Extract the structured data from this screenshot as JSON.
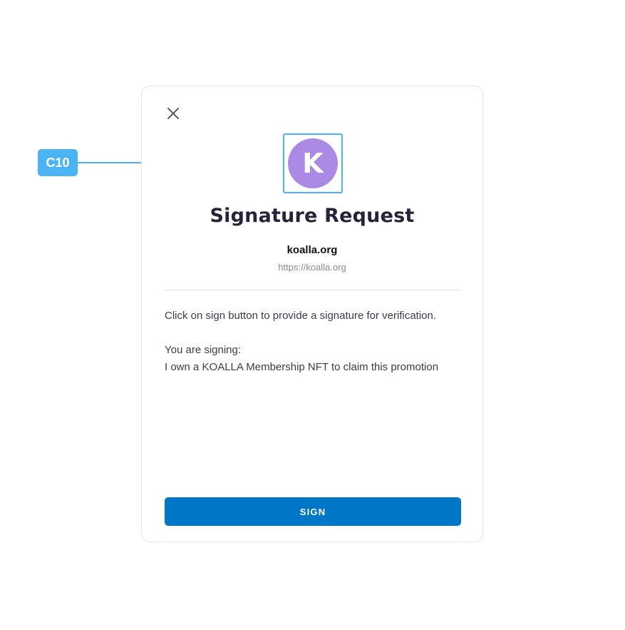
{
  "annotation": {
    "badge_label": "C10",
    "color": "#4bb4f5"
  },
  "dialog": {
    "close_icon": "close-icon",
    "avatar": {
      "letter": "K",
      "color": "#ab8ae6"
    },
    "title": "Signature Request",
    "site_name": "koalla.org",
    "site_url": "https://koalla.org",
    "instruction": "Click on sign button to provide a signature for verification.",
    "signing_label": "You are signing:",
    "signing_message": "I own a KOALLA Membership NFT to claim this promotion",
    "sign_button_label": "SIGN",
    "accent_color": "#0076c6"
  }
}
